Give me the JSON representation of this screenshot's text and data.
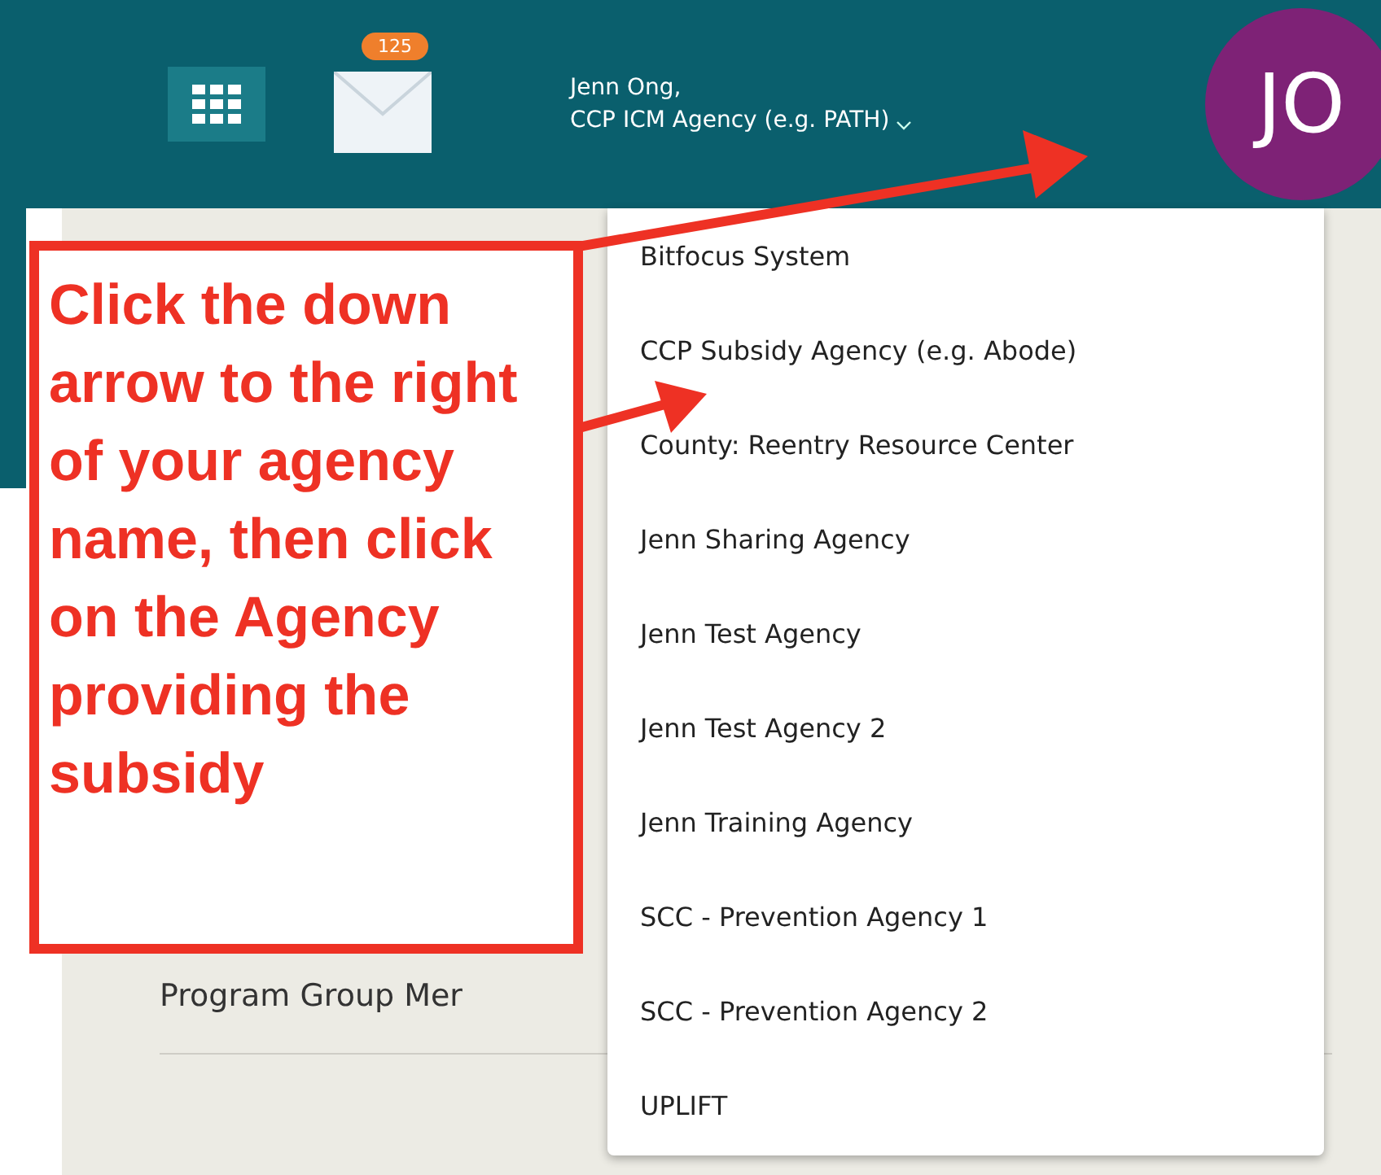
{
  "header": {
    "notifications_badge": "125",
    "user_name": "Jenn Ong,",
    "agency": "CCP ICM Agency (e.g. PATH)",
    "avatar_initials": "JO"
  },
  "page": {
    "section_label": "Program Group Mer"
  },
  "agency_menu": [
    {
      "label": "Bitfocus System"
    },
    {
      "label": "CCP Subsidy Agency (e.g. Abode)"
    },
    {
      "label": "County: Reentry Resource Center"
    },
    {
      "label": "Jenn Sharing Agency"
    },
    {
      "label": "Jenn Test Agency"
    },
    {
      "label": "Jenn Test Agency 2"
    },
    {
      "label": "Jenn Training Agency"
    },
    {
      "label": "SCC - Prevention Agency 1"
    },
    {
      "label": "SCC - Prevention Agency 2"
    },
    {
      "label": "UPLIFT"
    }
  ],
  "callout": {
    "text": "Click the down arrow to the right of your agency name, then click on the Agency providing the subsidy"
  }
}
